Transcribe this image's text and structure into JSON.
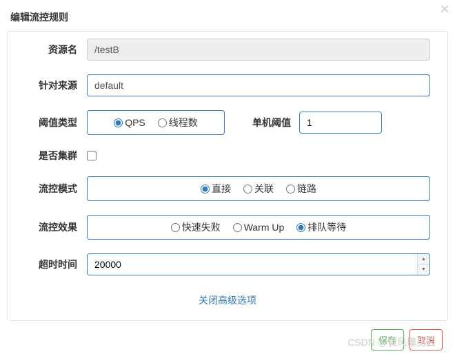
{
  "header": {
    "title": "编辑流控规则"
  },
  "form": {
    "resourceName": {
      "label": "资源名",
      "value": "/testB"
    },
    "limitApp": {
      "label": "针对来源",
      "value": "default"
    },
    "gradeType": {
      "label": "阈值类型",
      "options": {
        "qps": "QPS",
        "thread": "线程数"
      },
      "selected": "qps"
    },
    "singleThreshold": {
      "label": "单机阈值",
      "value": "1"
    },
    "cluster": {
      "label": "是否集群",
      "checked": false
    },
    "strategy": {
      "label": "流控模式",
      "options": {
        "direct": "直接",
        "relate": "关联",
        "chain": "链路"
      },
      "selected": "direct"
    },
    "controlBehavior": {
      "label": "流控效果",
      "options": {
        "fastfail": "快速失败",
        "warmup": "Warm Up",
        "queue": "排队等待"
      },
      "selected": "queue"
    },
    "timeout": {
      "label": "超时时间",
      "value": "20000"
    }
  },
  "toggleAdvanced": "关闭高级选项",
  "footer": {
    "save": "保存",
    "cancel": "取消"
  },
  "watermark": "CSDN @微风撞见云"
}
